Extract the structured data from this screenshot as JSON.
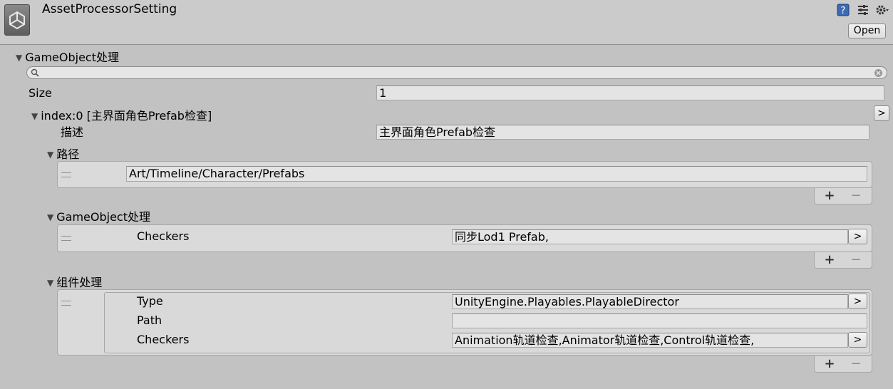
{
  "header": {
    "title": "AssetProcessorSetting",
    "open_label": "Open",
    "icons": [
      "help-icon",
      "preset-icon",
      "gear-icon"
    ]
  },
  "root": {
    "label": "GameObject处理",
    "search_placeholder": "",
    "size_label": "Size",
    "size_value": "1",
    "element": {
      "label": "index:0 [主界面角色Prefab检查]",
      "desc_label": "描述",
      "desc_value": "主界面角色Prefab检查",
      "path_section": {
        "label": "路径",
        "items": [
          "Art/Timeline/Character/Prefabs"
        ]
      },
      "gameobject_section": {
        "label": "GameObject处理",
        "checkers_label": "Checkers",
        "checkers_value": "同步Lod1 Prefab,"
      },
      "component_section": {
        "label": "组件处理",
        "type_label": "Type",
        "type_value": "UnityEngine.Playables.PlayableDirector",
        "path_label": "Path",
        "path_value": "",
        "checkers_label": "Checkers",
        "checkers_value": "Animation轨道检查,Animator轨道检查,Control轨道检查,"
      }
    }
  },
  "controls": {
    "plus": "+",
    "minus": "−",
    "arrow": ">"
  }
}
